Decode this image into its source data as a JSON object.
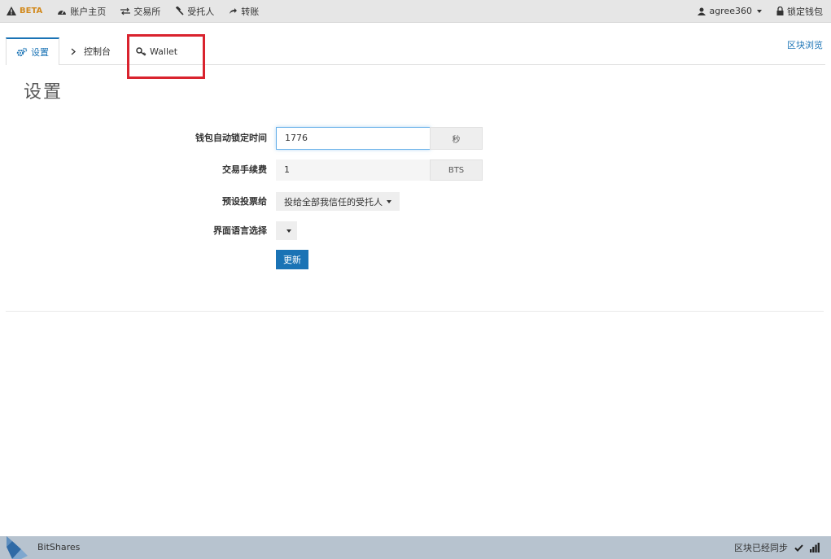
{
  "topbar": {
    "beta_label": "BETA",
    "nav": [
      {
        "label": "账户主页",
        "icon": "dashboard-icon"
      },
      {
        "label": "交易所",
        "icon": "exchange-icon"
      },
      {
        "label": "受托人",
        "icon": "gavel-icon"
      },
      {
        "label": "转账",
        "icon": "transfer-icon"
      }
    ],
    "account_name": "agree360",
    "lock_label": "锁定钱包"
  },
  "tabs": {
    "settings_label": "设置",
    "console_label": "控制台",
    "wallet_label": "Wallet"
  },
  "explorer_label": "区块浏览",
  "page_title": "设置",
  "form": {
    "autolock": {
      "label": "钱包自动锁定时间",
      "value": "1776",
      "unit": "秒"
    },
    "fee": {
      "label": "交易手续费",
      "value": "1",
      "unit": "BTS"
    },
    "vote": {
      "label": "预设投票给",
      "value": "投给全部我信任的受托人"
    },
    "language": {
      "label": "界面语言选择",
      "value": ""
    },
    "update_label": "更新"
  },
  "footer": {
    "brand": "BitShares",
    "sync_status": "区块已经同步"
  },
  "colors": {
    "accent": "#1a73b5",
    "highlight": "#d9232e",
    "beta": "#d28a1e",
    "footer_bg": "#b7c3cf"
  }
}
